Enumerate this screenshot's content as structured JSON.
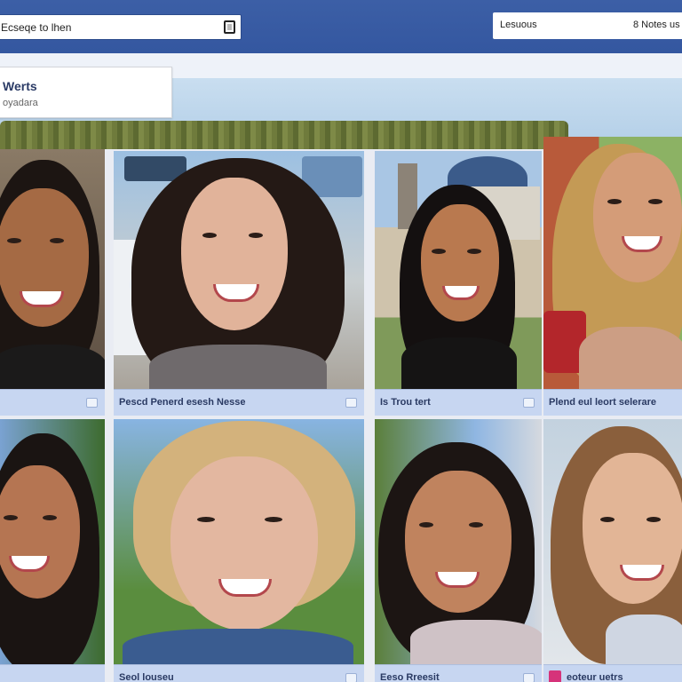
{
  "header": {
    "search_value": "Ecseqe to lhen",
    "account_left": "Lesuous",
    "account_right": "8 Notes us"
  },
  "profile": {
    "name": "Werts",
    "subtitle": "oyadara"
  },
  "photos": [
    {
      "caption": ""
    },
    {
      "caption": "Pescd Penerd esesh Nesse"
    },
    {
      "caption": "Is Trou tert"
    },
    {
      "caption": "Plend eul leort selerare"
    },
    {
      "caption": ""
    },
    {
      "caption": "Seol louseu"
    },
    {
      "caption": "Eeso Rreesit"
    },
    {
      "caption": "eoteur uetrs"
    }
  ],
  "colors": {
    "header_blue": "#3c5fa6",
    "caption_bg": "#c7d6f1",
    "caption_text": "#2a3a63",
    "badge": "#d6337a"
  },
  "icons": [
    "search-icon",
    "photo-action-icon",
    "badge-icon"
  ]
}
